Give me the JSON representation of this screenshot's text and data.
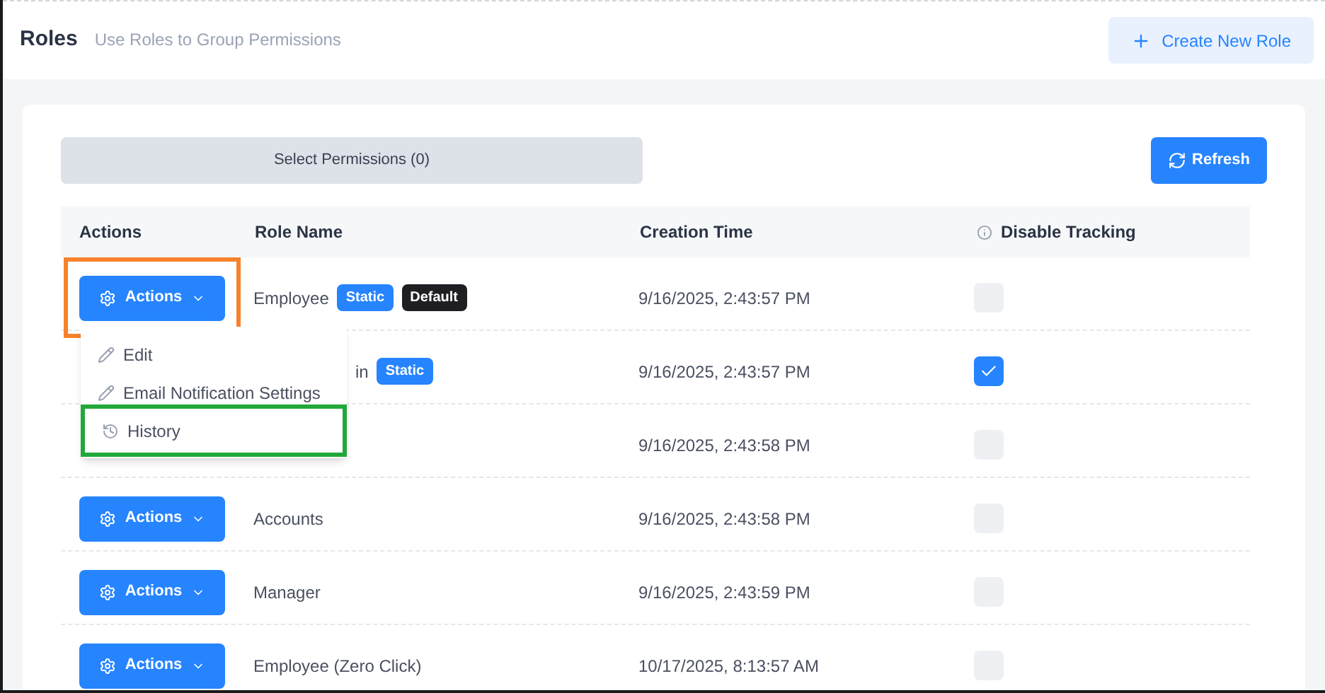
{
  "header": {
    "title": "Roles",
    "subtitle": "Use Roles to Group Permissions",
    "create_button": "Create New Role"
  },
  "toolbar": {
    "select_permissions": "Select Permissions (0)",
    "refresh": "Refresh"
  },
  "table": {
    "columns": [
      "Actions",
      "Role Name",
      "Creation Time",
      "Disable Tracking"
    ],
    "rows": [
      {
        "actions": "Actions",
        "highlighted": true,
        "name": "Employee",
        "badges": [
          {
            "label": "Static",
            "kind": "static"
          },
          {
            "label": "Default",
            "kind": "default"
          }
        ],
        "created": "9/16/2025, 2:43:57 PM",
        "checked": false
      },
      {
        "name": "in",
        "badges": [
          {
            "label": "Static",
            "kind": "static"
          }
        ],
        "created": "9/16/2025, 2:43:57 PM",
        "checked": true
      },
      {
        "created": "9/16/2025, 2:43:58 PM",
        "checked": false
      },
      {
        "actions": "Actions",
        "highlighted": false,
        "name": "Accounts",
        "created": "9/16/2025, 2:43:58 PM",
        "checked": false
      },
      {
        "actions": "Actions",
        "highlighted": false,
        "name": "Manager",
        "created": "9/16/2025, 2:43:59 PM",
        "checked": false
      },
      {
        "actions": "Actions",
        "highlighted": false,
        "name": "Employee (Zero Click)",
        "created": "10/17/2025, 8:13:57 AM",
        "checked": false
      }
    ]
  },
  "menu": {
    "items": [
      {
        "label": "Edit",
        "kind": "pencil",
        "highlighted": false
      },
      {
        "label": "Email Notification Settings",
        "kind": "pencil",
        "highlighted": false
      },
      {
        "label": "History",
        "kind": "history",
        "highlighted": true
      }
    ]
  }
}
